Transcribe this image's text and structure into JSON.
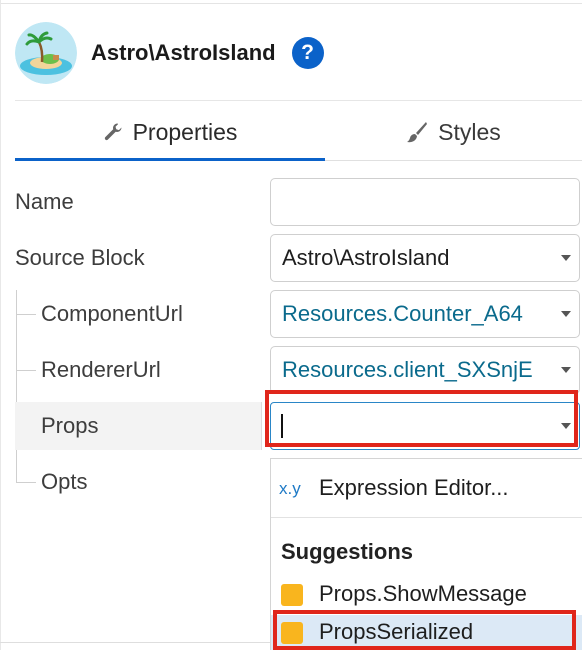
{
  "header": {
    "logo": "island-logo",
    "title": "Astro\\AstroIsland",
    "help_icon": "question-circle-icon",
    "help_label": "?"
  },
  "tabs": [
    {
      "label": "Properties",
      "icon": "wrench-icon",
      "active": true
    },
    {
      "label": "Styles",
      "icon": "brush-icon",
      "active": false
    }
  ],
  "properties": {
    "name": {
      "label": "Name",
      "value": ""
    },
    "source_block": {
      "label": "Source Block",
      "value": "Astro\\AstroIsland"
    },
    "component_url": {
      "label": "ComponentUrl",
      "value": "Resources.Counter_A64"
    },
    "renderer_url": {
      "label": "RendererUrl",
      "value": "Resources.client_SXSnjE"
    },
    "props": {
      "label": "Props",
      "value": ""
    },
    "opts": {
      "label": "Opts"
    }
  },
  "dropdown": {
    "expression_icon": "x.y",
    "expression_label": "Expression Editor...",
    "suggestions_heading": "Suggestions",
    "items": [
      {
        "label": "Props.ShowMessage",
        "selected": false
      },
      {
        "label": "PropsSerialized",
        "selected": true
      }
    ]
  },
  "colors": {
    "accent": "#0b62c9",
    "highlight_box": "#e0261b",
    "suggestion_swatch": "#f9b51e",
    "link_text": "#0a6a8c"
  }
}
